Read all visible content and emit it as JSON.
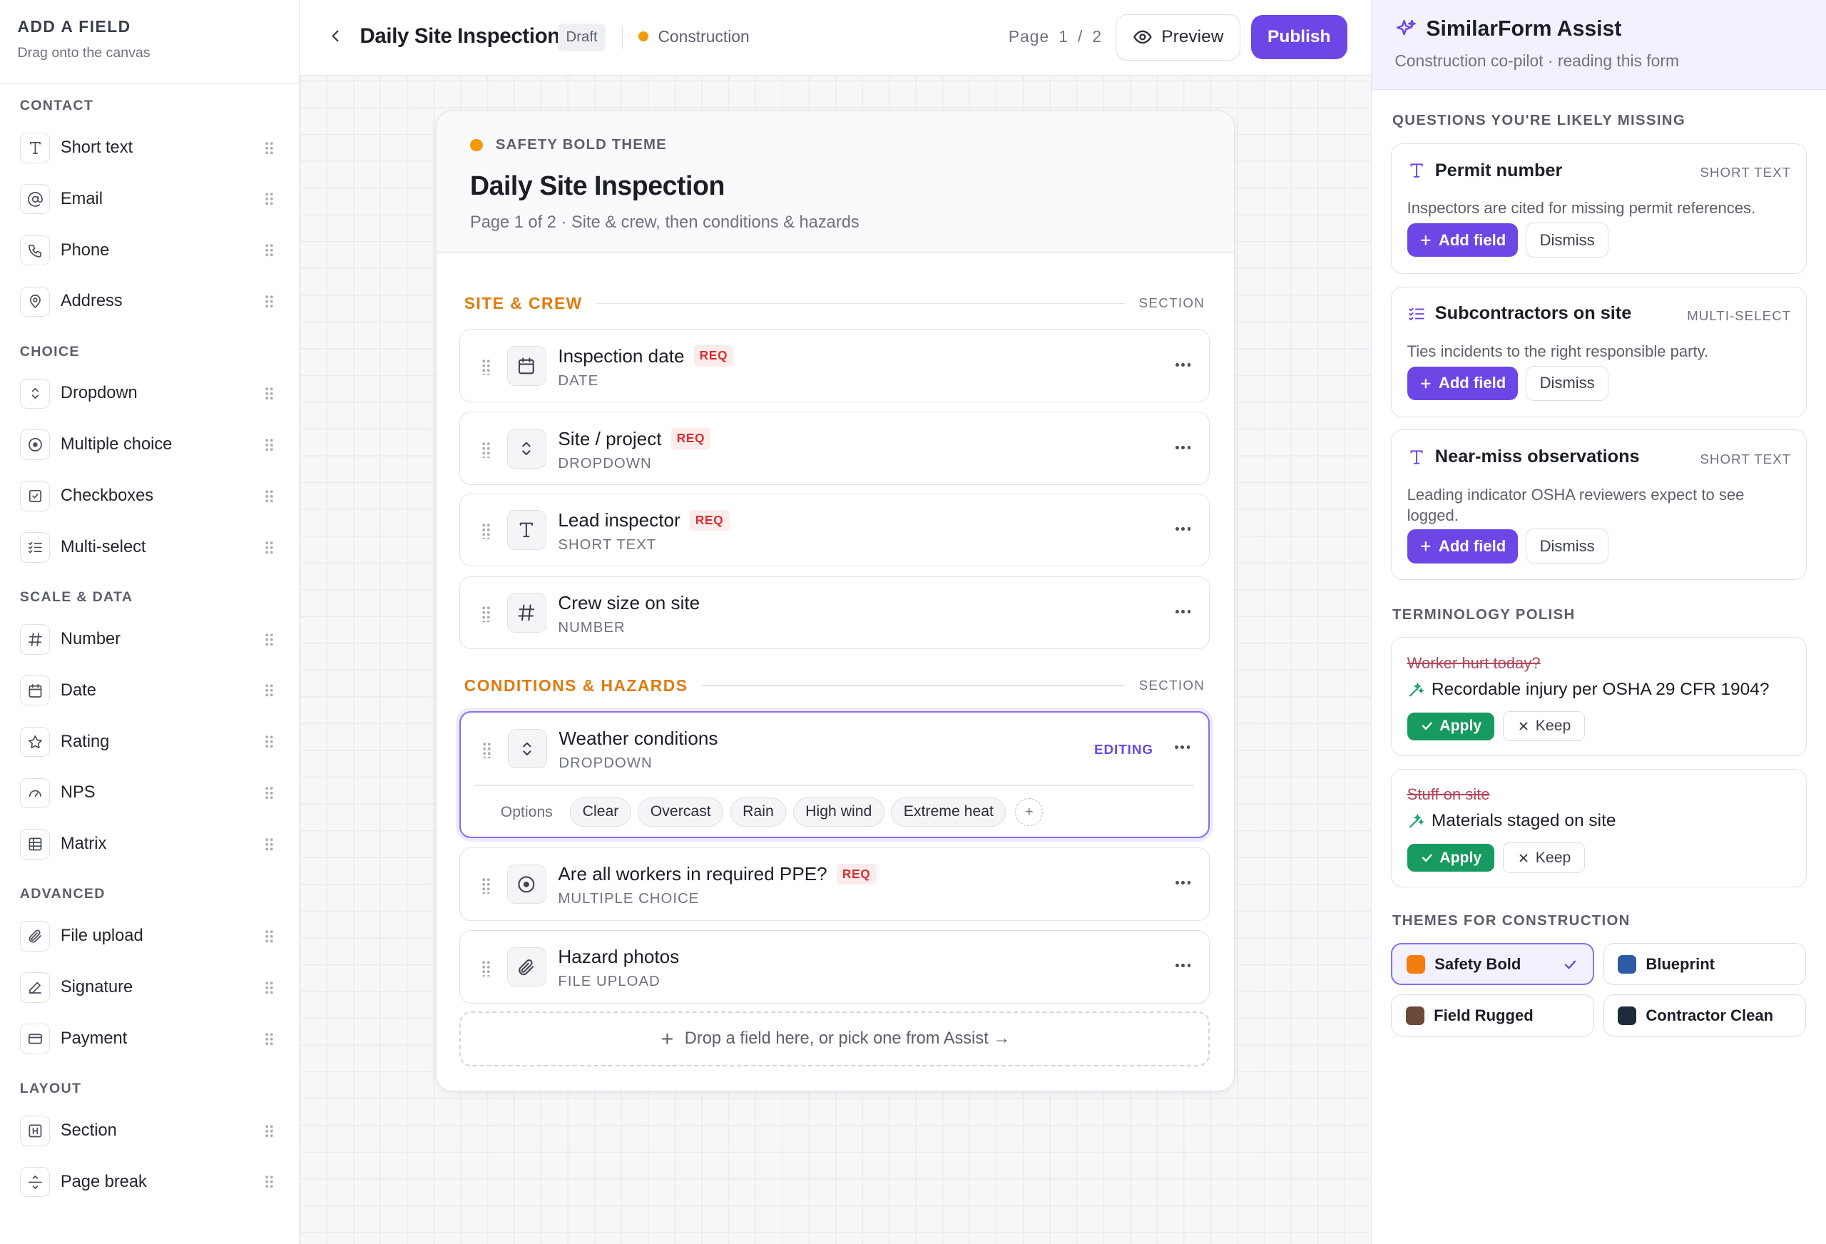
{
  "palette": {
    "title": "ADD A FIELD",
    "subtitle": "Drag onto the canvas",
    "categories": [
      {
        "label": "CONTACT",
        "items": [
          "Short text",
          "Email",
          "Phone",
          "Address"
        ]
      },
      {
        "label": "CHOICE",
        "items": [
          "Dropdown",
          "Multiple choice",
          "Checkboxes",
          "Multi-select"
        ]
      },
      {
        "label": "SCALE & DATA",
        "items": [
          "Number",
          "Date",
          "Rating",
          "NPS",
          "Matrix"
        ]
      },
      {
        "label": "ADVANCED",
        "items": [
          "File upload",
          "Signature",
          "Payment"
        ]
      },
      {
        "label": "LAYOUT",
        "items": [
          "Section",
          "Page break"
        ]
      }
    ],
    "icons": {
      "Short text": "text-icon",
      "Email": "at-sign-icon",
      "Phone": "phone-icon",
      "Address": "map-pin-icon",
      "Dropdown": "chevron-updown-icon",
      "Multiple choice": "radio-icon",
      "Checkboxes": "checkbox-icon",
      "Multi-select": "list-check-icon",
      "Number": "hash-icon",
      "Date": "calendar-icon",
      "Rating": "star-icon",
      "NPS": "gauge-icon",
      "Matrix": "grid-icon",
      "File upload": "paperclip-icon",
      "Signature": "pen-icon",
      "Payment": "credit-card-icon",
      "Section": "heading-icon",
      "Page break": "page-break-icon"
    }
  },
  "topbar": {
    "title": "Daily Site Inspection",
    "status": "Draft",
    "industry": "Construction",
    "page_label": "Page",
    "page_current": "1",
    "page_sep": "/",
    "page_total": "2",
    "preview_label": "Preview",
    "publish_label": "Publish"
  },
  "form": {
    "theme_label": "SAFETY BOLD THEME",
    "title": "Daily Site Inspection",
    "subtitle": "Page 1 of 2 · Site & crew, then conditions & hazards",
    "section_tag": "SECTION",
    "req_label": "REQ",
    "sections": [
      {
        "name": "SITE & CREW"
      },
      {
        "name": "CONDITIONS & HAZARDS"
      }
    ],
    "fields": [
      {
        "name": "Inspection date",
        "type": "DATE",
        "required": true,
        "icon": "calendar-icon"
      },
      {
        "name": "Site / project",
        "type": "DROPDOWN",
        "required": true,
        "icon": "chevron-updown-icon"
      },
      {
        "name": "Lead inspector",
        "type": "SHORT TEXT",
        "required": true,
        "icon": "text-icon"
      },
      {
        "name": "Crew size on site",
        "type": "NUMBER",
        "required": false,
        "icon": "hash-icon"
      },
      {
        "name": "Weather conditions",
        "type": "DROPDOWN",
        "required": false,
        "icon": "chevron-updown-icon",
        "editing": true
      },
      {
        "name": "Are all workers in required PPE?",
        "type": "MULTIPLE CHOICE",
        "required": true,
        "icon": "radio-icon"
      },
      {
        "name": "Hazard photos",
        "type": "FILE UPLOAD",
        "required": false,
        "icon": "paperclip-icon"
      }
    ],
    "editing_label": "EDITING",
    "options_label": "Options",
    "options": [
      "Clear",
      "Overcast",
      "Rain",
      "High wind",
      "Extreme heat"
    ],
    "add_option": "+",
    "dropzone": "Drop a field here, or pick one from Assist →"
  },
  "assist": {
    "title": "SimilarForm Assist",
    "subtitle": "Construction co-pilot · reading this form",
    "missing_heading": "QUESTIONS YOU'RE LIKELY MISSING",
    "add_label": "Add field",
    "dismiss_label": "Dismiss",
    "suggestions": [
      {
        "name": "Permit number",
        "kind": "SHORT TEXT",
        "desc": "Inspectors are cited for missing permit references.",
        "icon": "text-icon"
      },
      {
        "name": "Subcontractors on site",
        "kind": "MULTI-SELECT",
        "desc": "Ties incidents to the right responsible party.",
        "icon": "list-check-icon"
      },
      {
        "name": "Near-miss observations",
        "kind": "SHORT TEXT",
        "desc": "Leading indicator OSHA reviewers expect to see logged.",
        "icon": "text-icon"
      }
    ],
    "polish_heading": "TERMINOLOGY POLISH",
    "apply_label": "Apply",
    "keep_label": "Keep",
    "polish": [
      {
        "old": "Worker hurt today?",
        "new": "Recordable injury per OSHA 29 CFR 1904?"
      },
      {
        "old": "Stuff on site",
        "new": "Materials staged on site"
      }
    ],
    "themes_heading": "THEMES FOR CONSTRUCTION",
    "themes": [
      {
        "name": "Safety Bold",
        "color": "#f57c0f",
        "selected": true
      },
      {
        "name": "Blueprint",
        "color": "#2c5aa3",
        "selected": false
      },
      {
        "name": "Field Rugged",
        "color": "#6b4a3a",
        "selected": false
      },
      {
        "name": "Contractor Clean",
        "color": "#1f2a3c",
        "selected": false
      }
    ]
  },
  "colors": {
    "accent": "#6d47e6",
    "section": "#e07b0e",
    "required": "#d92d2d",
    "apply": "#169a5f",
    "industry_dot": "#f29c0c"
  }
}
